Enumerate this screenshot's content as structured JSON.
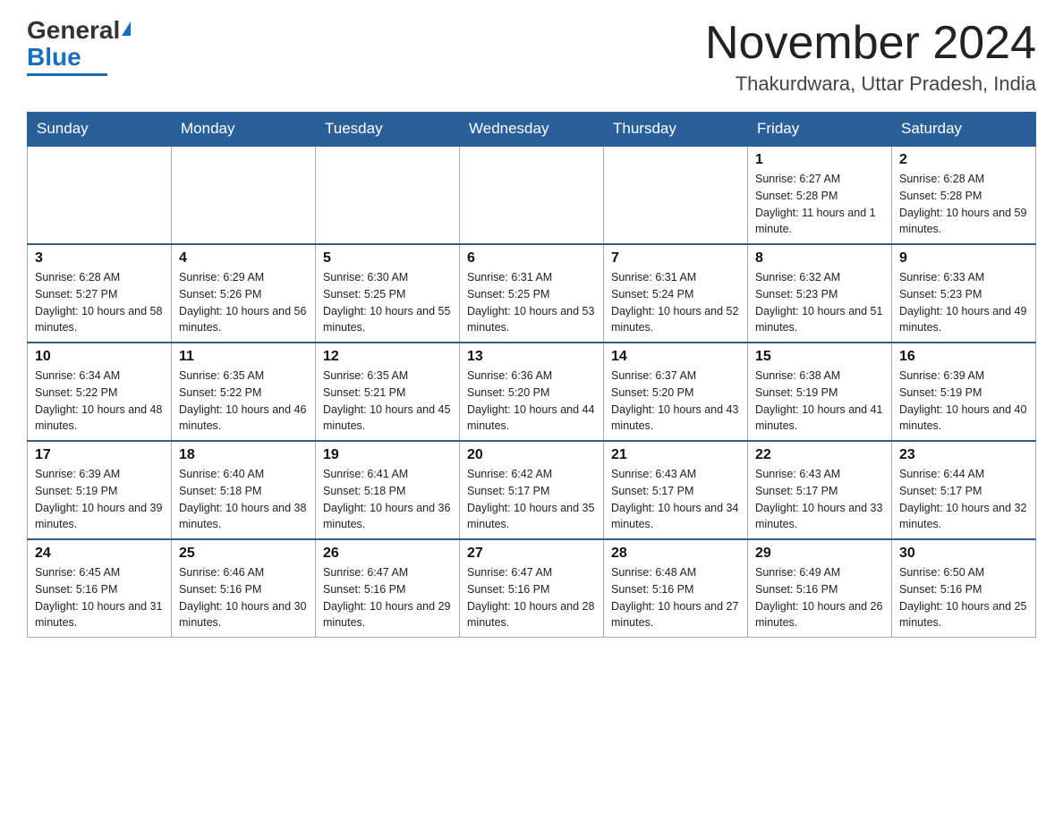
{
  "logo": {
    "general": "General",
    "blue": "Blue"
  },
  "header": {
    "month": "November 2024",
    "location": "Thakurdwara, Uttar Pradesh, India"
  },
  "days_of_week": [
    "Sunday",
    "Monday",
    "Tuesday",
    "Wednesday",
    "Thursday",
    "Friday",
    "Saturday"
  ],
  "weeks": [
    [
      {
        "day": "",
        "info": ""
      },
      {
        "day": "",
        "info": ""
      },
      {
        "day": "",
        "info": ""
      },
      {
        "day": "",
        "info": ""
      },
      {
        "day": "",
        "info": ""
      },
      {
        "day": "1",
        "info": "Sunrise: 6:27 AM\nSunset: 5:28 PM\nDaylight: 11 hours and 1 minute."
      },
      {
        "day": "2",
        "info": "Sunrise: 6:28 AM\nSunset: 5:28 PM\nDaylight: 10 hours and 59 minutes."
      }
    ],
    [
      {
        "day": "3",
        "info": "Sunrise: 6:28 AM\nSunset: 5:27 PM\nDaylight: 10 hours and 58 minutes."
      },
      {
        "day": "4",
        "info": "Sunrise: 6:29 AM\nSunset: 5:26 PM\nDaylight: 10 hours and 56 minutes."
      },
      {
        "day": "5",
        "info": "Sunrise: 6:30 AM\nSunset: 5:25 PM\nDaylight: 10 hours and 55 minutes."
      },
      {
        "day": "6",
        "info": "Sunrise: 6:31 AM\nSunset: 5:25 PM\nDaylight: 10 hours and 53 minutes."
      },
      {
        "day": "7",
        "info": "Sunrise: 6:31 AM\nSunset: 5:24 PM\nDaylight: 10 hours and 52 minutes."
      },
      {
        "day": "8",
        "info": "Sunrise: 6:32 AM\nSunset: 5:23 PM\nDaylight: 10 hours and 51 minutes."
      },
      {
        "day": "9",
        "info": "Sunrise: 6:33 AM\nSunset: 5:23 PM\nDaylight: 10 hours and 49 minutes."
      }
    ],
    [
      {
        "day": "10",
        "info": "Sunrise: 6:34 AM\nSunset: 5:22 PM\nDaylight: 10 hours and 48 minutes."
      },
      {
        "day": "11",
        "info": "Sunrise: 6:35 AM\nSunset: 5:22 PM\nDaylight: 10 hours and 46 minutes."
      },
      {
        "day": "12",
        "info": "Sunrise: 6:35 AM\nSunset: 5:21 PM\nDaylight: 10 hours and 45 minutes."
      },
      {
        "day": "13",
        "info": "Sunrise: 6:36 AM\nSunset: 5:20 PM\nDaylight: 10 hours and 44 minutes."
      },
      {
        "day": "14",
        "info": "Sunrise: 6:37 AM\nSunset: 5:20 PM\nDaylight: 10 hours and 43 minutes."
      },
      {
        "day": "15",
        "info": "Sunrise: 6:38 AM\nSunset: 5:19 PM\nDaylight: 10 hours and 41 minutes."
      },
      {
        "day": "16",
        "info": "Sunrise: 6:39 AM\nSunset: 5:19 PM\nDaylight: 10 hours and 40 minutes."
      }
    ],
    [
      {
        "day": "17",
        "info": "Sunrise: 6:39 AM\nSunset: 5:19 PM\nDaylight: 10 hours and 39 minutes."
      },
      {
        "day": "18",
        "info": "Sunrise: 6:40 AM\nSunset: 5:18 PM\nDaylight: 10 hours and 38 minutes."
      },
      {
        "day": "19",
        "info": "Sunrise: 6:41 AM\nSunset: 5:18 PM\nDaylight: 10 hours and 36 minutes."
      },
      {
        "day": "20",
        "info": "Sunrise: 6:42 AM\nSunset: 5:17 PM\nDaylight: 10 hours and 35 minutes."
      },
      {
        "day": "21",
        "info": "Sunrise: 6:43 AM\nSunset: 5:17 PM\nDaylight: 10 hours and 34 minutes."
      },
      {
        "day": "22",
        "info": "Sunrise: 6:43 AM\nSunset: 5:17 PM\nDaylight: 10 hours and 33 minutes."
      },
      {
        "day": "23",
        "info": "Sunrise: 6:44 AM\nSunset: 5:17 PM\nDaylight: 10 hours and 32 minutes."
      }
    ],
    [
      {
        "day": "24",
        "info": "Sunrise: 6:45 AM\nSunset: 5:16 PM\nDaylight: 10 hours and 31 minutes."
      },
      {
        "day": "25",
        "info": "Sunrise: 6:46 AM\nSunset: 5:16 PM\nDaylight: 10 hours and 30 minutes."
      },
      {
        "day": "26",
        "info": "Sunrise: 6:47 AM\nSunset: 5:16 PM\nDaylight: 10 hours and 29 minutes."
      },
      {
        "day": "27",
        "info": "Sunrise: 6:47 AM\nSunset: 5:16 PM\nDaylight: 10 hours and 28 minutes."
      },
      {
        "day": "28",
        "info": "Sunrise: 6:48 AM\nSunset: 5:16 PM\nDaylight: 10 hours and 27 minutes."
      },
      {
        "day": "29",
        "info": "Sunrise: 6:49 AM\nSunset: 5:16 PM\nDaylight: 10 hours and 26 minutes."
      },
      {
        "day": "30",
        "info": "Sunrise: 6:50 AM\nSunset: 5:16 PM\nDaylight: 10 hours and 25 minutes."
      }
    ]
  ]
}
